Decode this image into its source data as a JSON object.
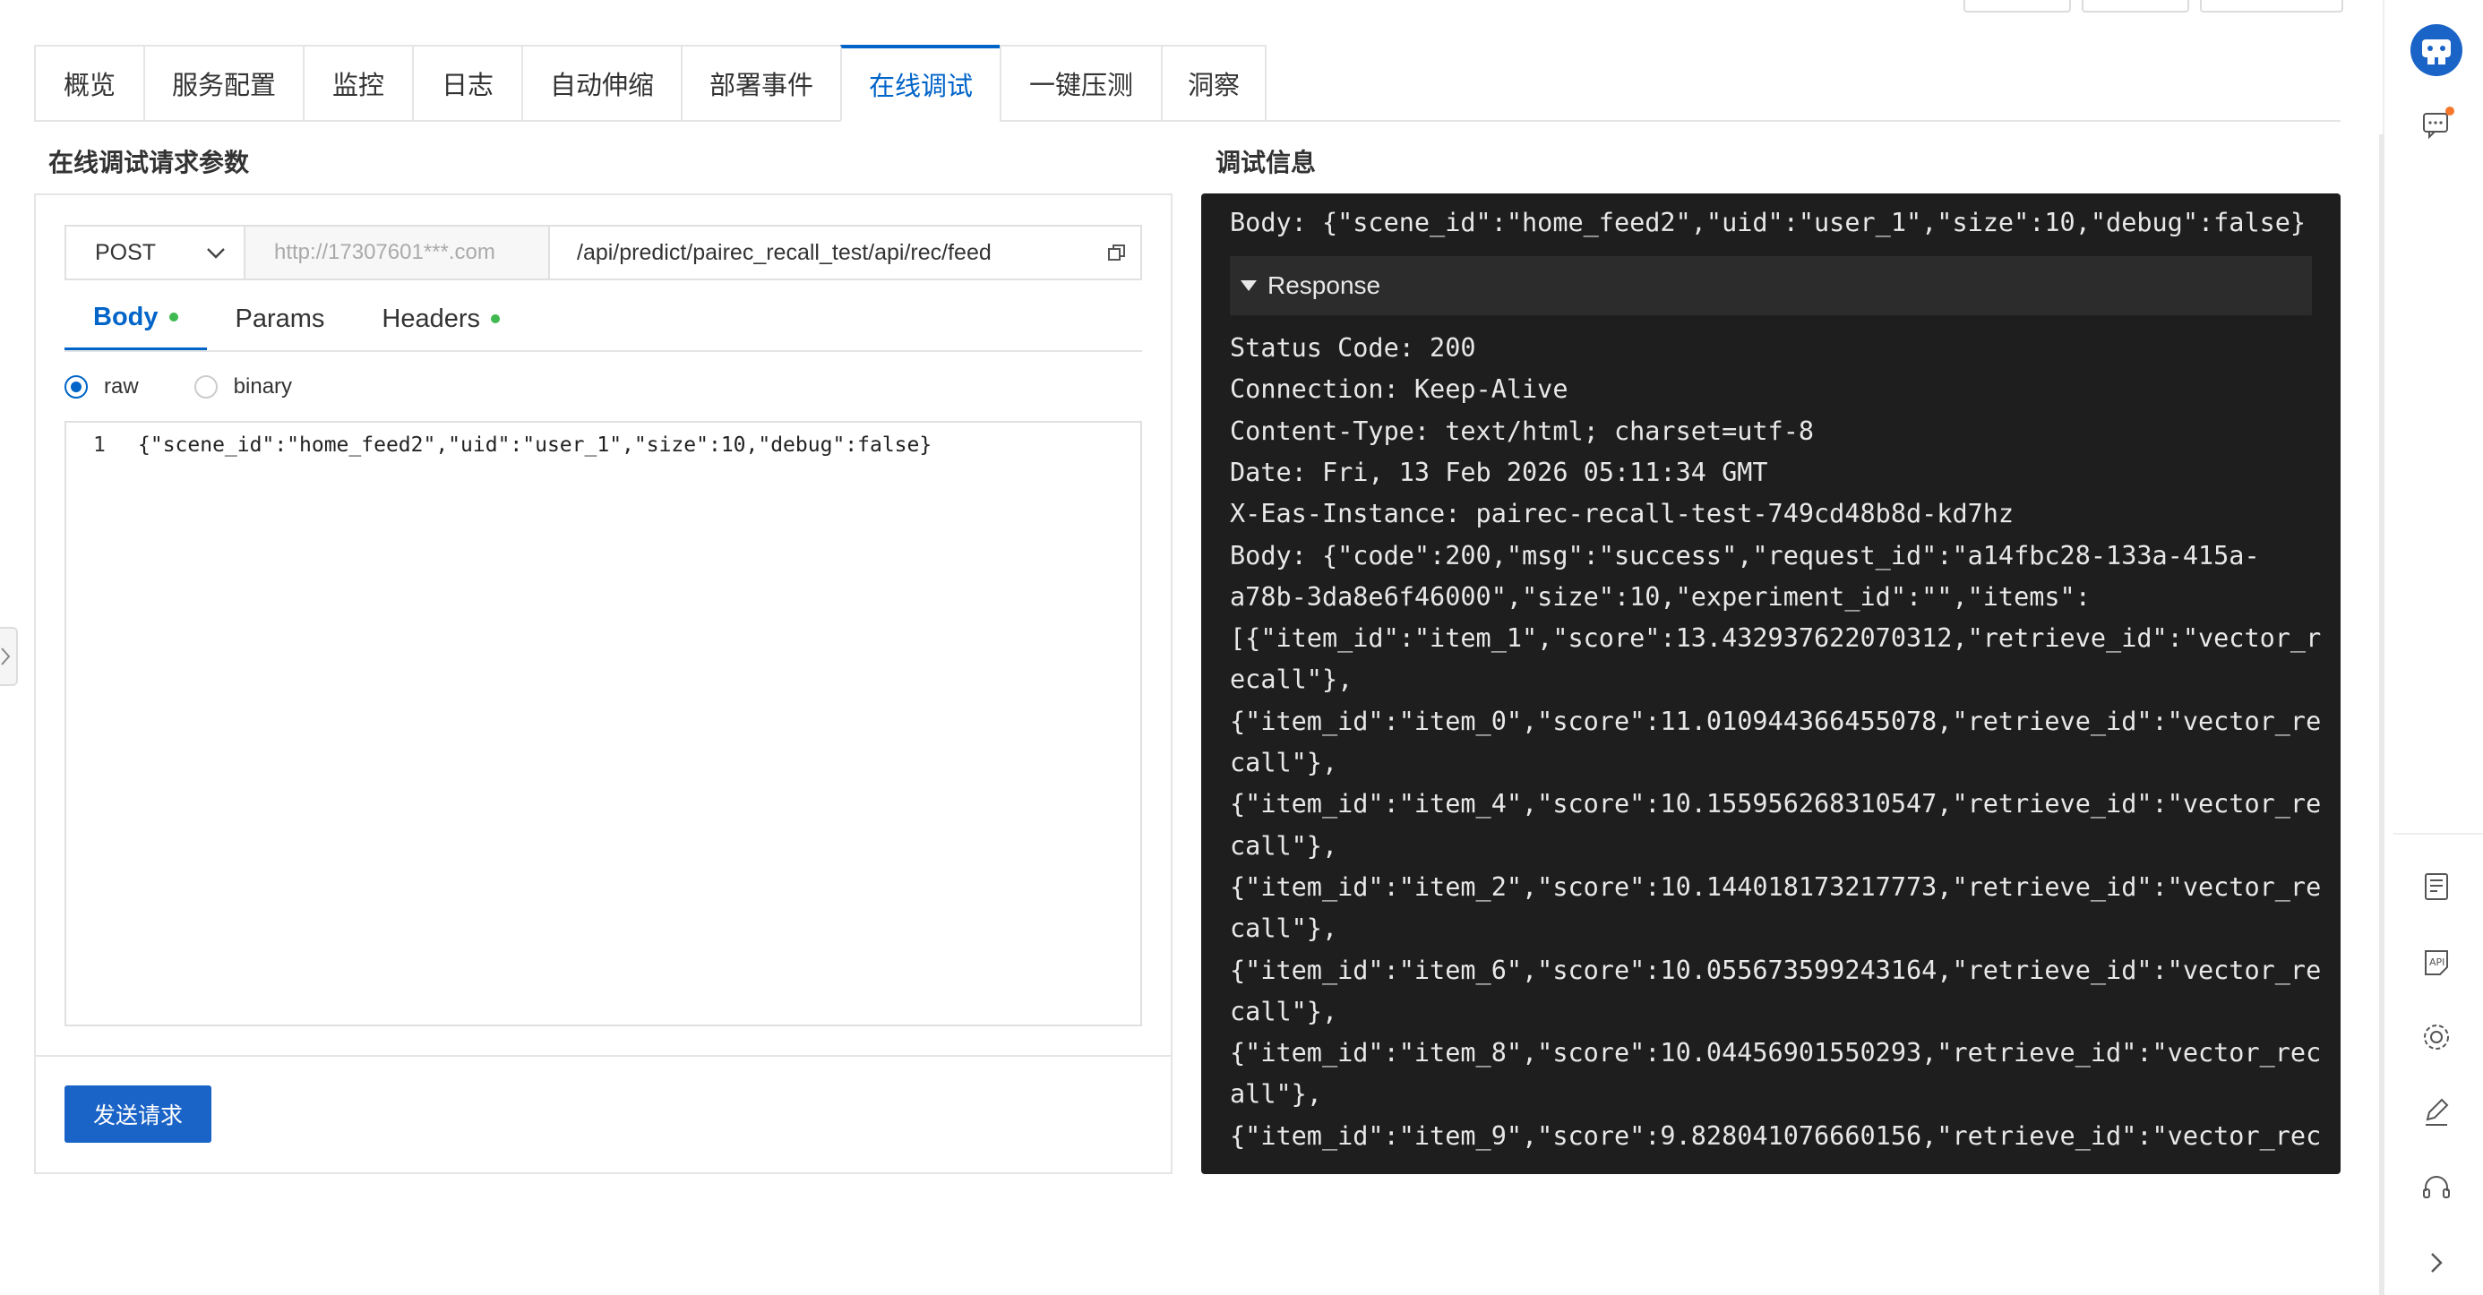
{
  "tabs": [
    "概览",
    "服务配置",
    "监控",
    "日志",
    "自动伸缩",
    "部署事件",
    "在线调试",
    "一键压测",
    "洞察"
  ],
  "active_tab": "在线调试",
  "left": {
    "title": "在线调试请求参数",
    "method": "POST",
    "host": "http://17307601***.com",
    "path": "/api/predict/pairec_recall_test/api/rec/feed",
    "subtabs": {
      "body": "Body",
      "params": "Params",
      "headers": "Headers"
    },
    "radio": {
      "raw": "raw",
      "binary": "binary"
    },
    "editor": {
      "line_no": "1",
      "code": "{\"scene_id\":\"home_feed2\",\"uid\":\"user_1\",\"size\":10,\"debug\":false}"
    },
    "send": "发送请求"
  },
  "right": {
    "title": "调试信息",
    "request_body": "Body: {\"scene_id\":\"home_feed2\",\"uid\":\"user_1\",\"size\":10,\"debug\":false}",
    "response_label": "Response",
    "lines": [
      "Status Code: 200",
      "Connection: Keep-Alive",
      "Content-Type: text/html; charset=utf-8",
      "Date: Fri, 13 Feb 2026 05:11:34 GMT",
      "X-Eas-Instance: pairec-recall-test-749cd48b8d-kd7hz",
      "Body: {\"code\":200,\"msg\":\"success\",\"request_id\":\"a14fbc28-133a-415a-",
      "a78b-3da8e6f46000\",\"size\":10,\"experiment_id\":\"\",\"items\":",
      "[{\"item_id\":\"item_1\",\"score\":13.432937622070312,\"retrieve_id\":\"vector_r",
      "ecall\"},",
      "{\"item_id\":\"item_0\",\"score\":11.010944366455078,\"retrieve_id\":\"vector_re",
      "call\"},",
      "{\"item_id\":\"item_4\",\"score\":10.155956268310547,\"retrieve_id\":\"vector_re",
      "call\"},",
      "{\"item_id\":\"item_2\",\"score\":10.144018173217773,\"retrieve_id\":\"vector_re",
      "call\"},",
      "{\"item_id\":\"item_6\",\"score\":10.055673599243164,\"retrieve_id\":\"vector_re",
      "call\"},",
      "{\"item_id\":\"item_8\",\"score\":10.04456901550293,\"retrieve_id\":\"vector_rec",
      "all\"},",
      "{\"item_id\":\"item_9\",\"score\":9.828041076660156,\"retrieve_id\":\"vector_rec"
    ]
  },
  "colors": {
    "accent": "#0064c8",
    "button": "#1a63c7",
    "dot": "#3fb950",
    "panel_dark": "#1e1e1e",
    "notify": "#f5772b"
  }
}
